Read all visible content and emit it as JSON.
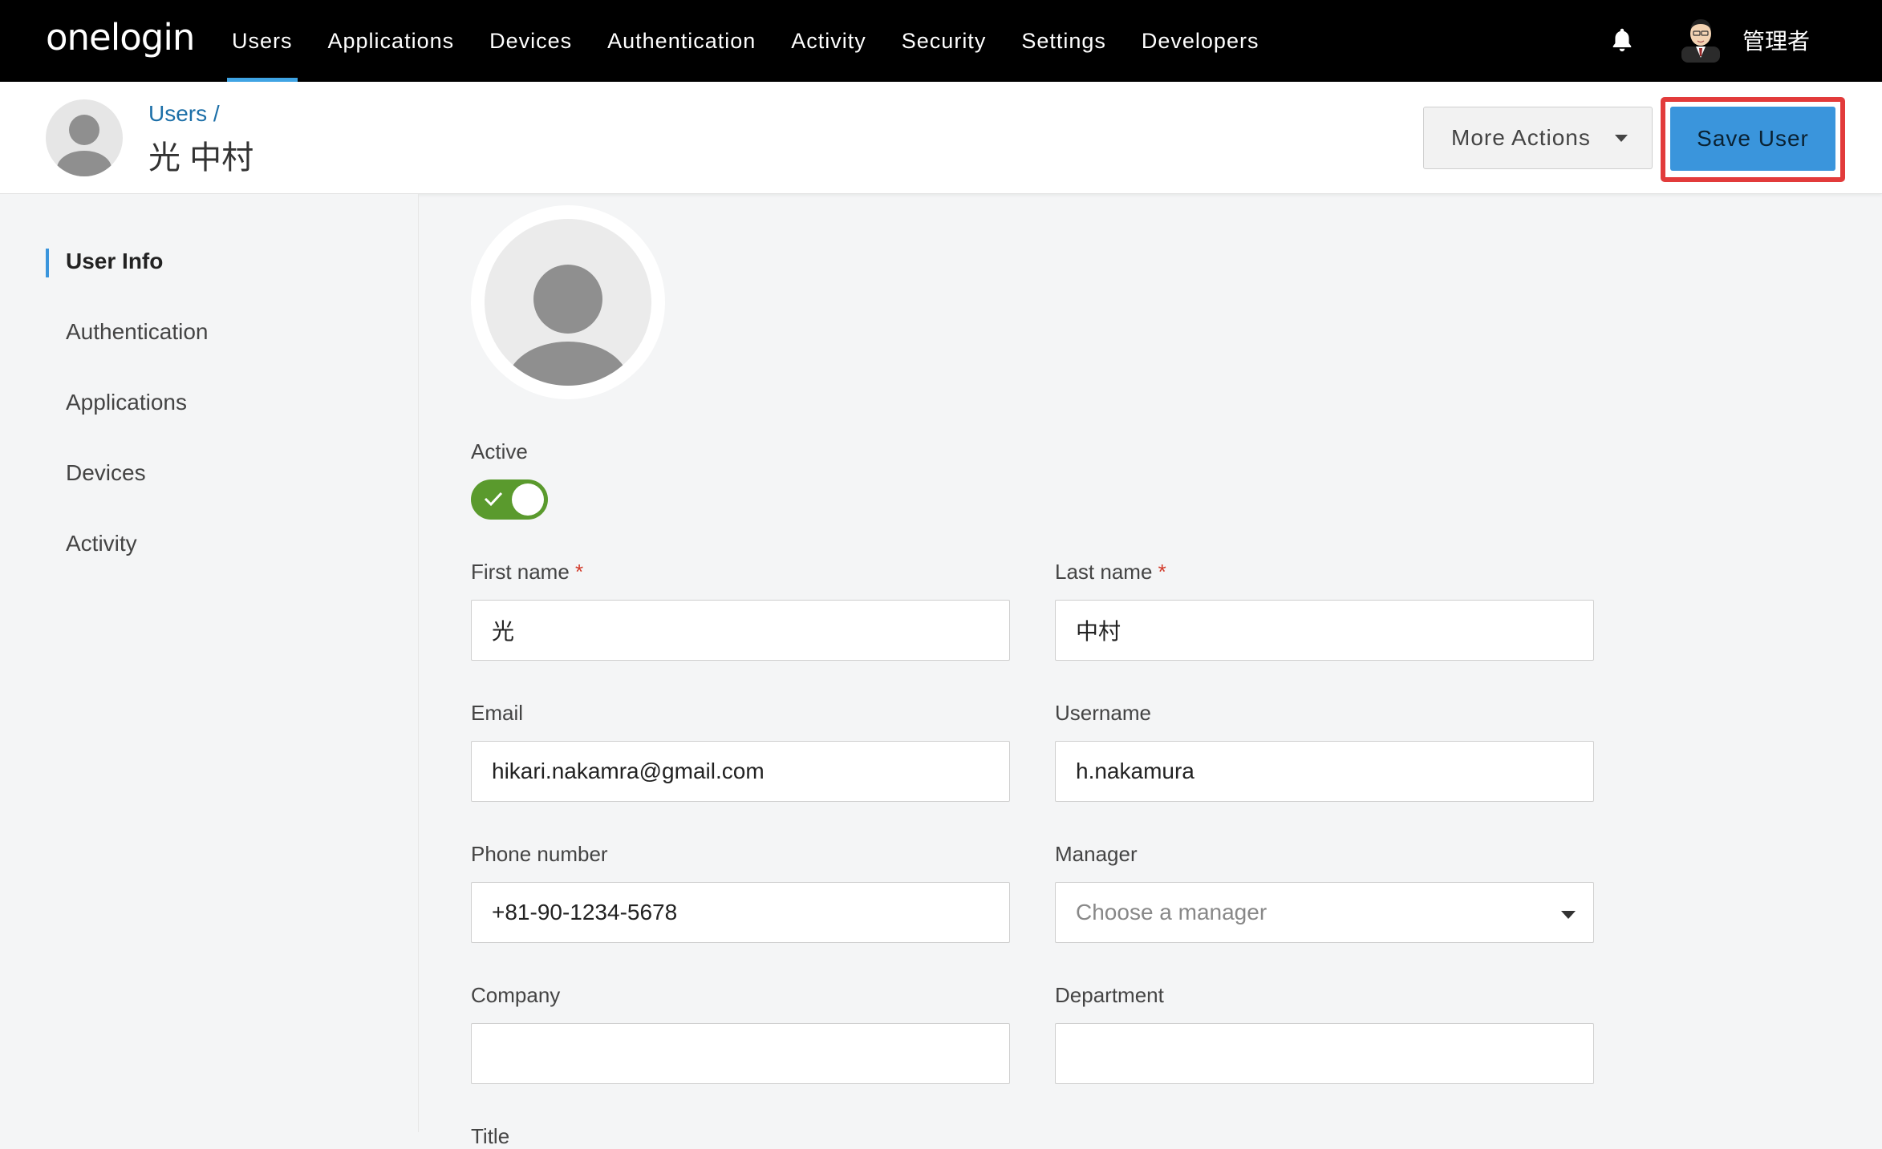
{
  "app": {
    "logo": "onelogin"
  },
  "nav": {
    "items": [
      "Users",
      "Applications",
      "Devices",
      "Authentication",
      "Activity",
      "Security",
      "Settings",
      "Developers"
    ],
    "active": "Users",
    "bell_icon": "bell-icon",
    "admin_name": "管理者"
  },
  "header": {
    "breadcrumb": "Users /",
    "title": "光 中村",
    "more_actions_label": "More Actions",
    "save_label": "Save User",
    "highlight_color": "#e23b3b",
    "primary_color": "#3a95dc"
  },
  "sidebar": {
    "items": [
      {
        "label": "User Info",
        "active": true
      },
      {
        "label": "Authentication"
      },
      {
        "label": "Applications"
      },
      {
        "label": "Devices"
      },
      {
        "label": "Activity"
      }
    ]
  },
  "form": {
    "active_label": "Active",
    "active_on": true,
    "toggle_color": "#5a9a2d",
    "first_name": {
      "label": "First name",
      "required": "*",
      "value": "光"
    },
    "last_name": {
      "label": "Last name",
      "required": "*",
      "value": "中村"
    },
    "email": {
      "label": "Email",
      "value": "hikari.nakamra@gmail.com"
    },
    "username": {
      "label": "Username",
      "value": "h.nakamura"
    },
    "phone": {
      "label": "Phone number",
      "value": "+81-90-1234-5678"
    },
    "manager": {
      "label": "Manager",
      "placeholder": "Choose a manager"
    },
    "company": {
      "label": "Company",
      "value": ""
    },
    "department": {
      "label": "Department",
      "value": ""
    },
    "title": {
      "label": "Title"
    }
  }
}
